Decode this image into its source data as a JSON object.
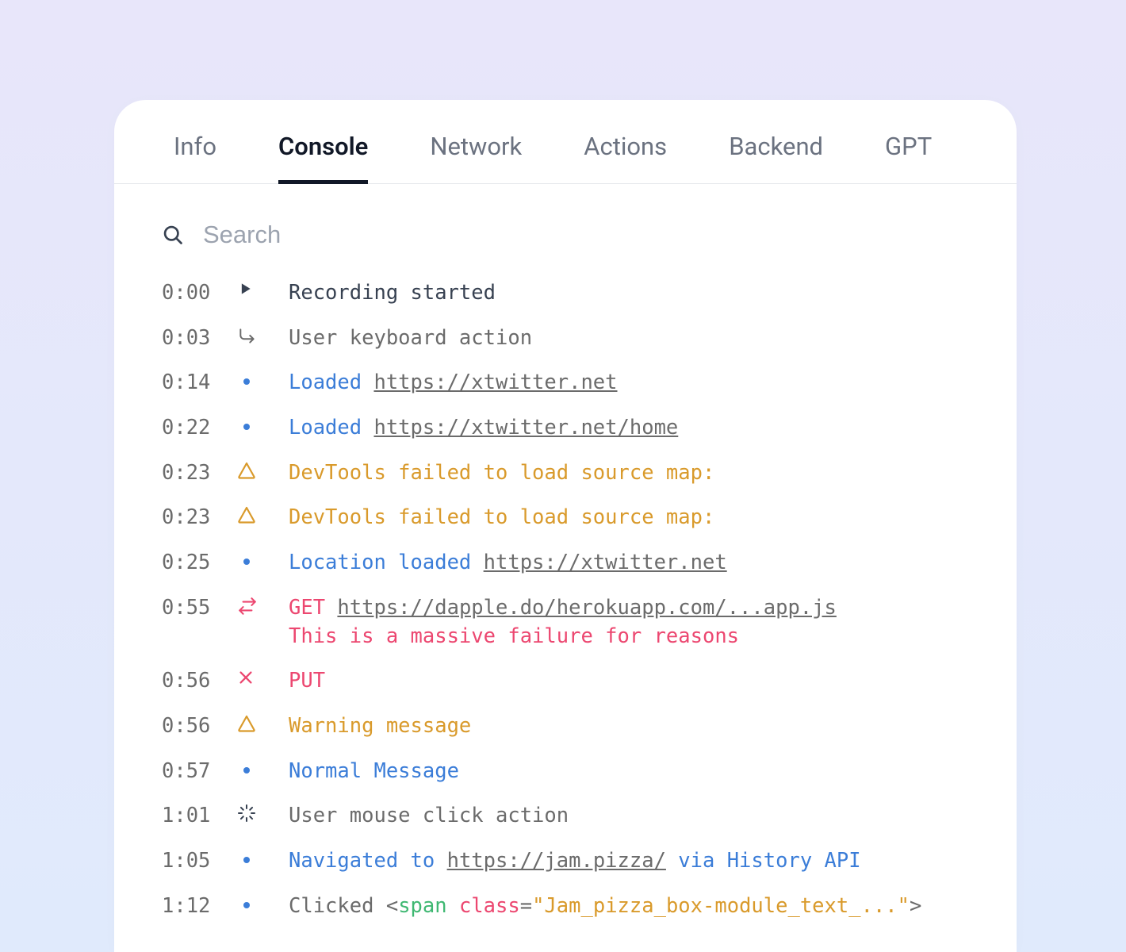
{
  "tabs": [
    {
      "label": "Info",
      "active": false
    },
    {
      "label": "Console",
      "active": true
    },
    {
      "label": "Network",
      "active": false
    },
    {
      "label": "Actions",
      "active": false
    },
    {
      "label": "Backend",
      "active": false
    },
    {
      "label": "GPT",
      "active": false
    }
  ],
  "search": {
    "placeholder": "Search"
  },
  "log": [
    {
      "ts": "0:00",
      "icon": "play",
      "msg_parts": [
        {
          "t": "Recording started",
          "c": "default"
        }
      ]
    },
    {
      "ts": "0:03",
      "icon": "sub-arrow",
      "msg_parts": [
        {
          "t": "User keyboard action",
          "c": "gray"
        }
      ]
    },
    {
      "ts": "0:14",
      "icon": "dot",
      "msg_parts": [
        {
          "t": "Loaded ",
          "c": "blue"
        },
        {
          "t": "https://xtwitter.net",
          "c": "link"
        }
      ]
    },
    {
      "ts": "0:22",
      "icon": "dot",
      "msg_parts": [
        {
          "t": "Loaded ",
          "c": "blue"
        },
        {
          "t": "https://xtwitter.net/home",
          "c": "link"
        }
      ]
    },
    {
      "ts": "0:23",
      "icon": "warn",
      "msg_parts": [
        {
          "t": "DevTools failed to load source map:",
          "c": "warn"
        }
      ]
    },
    {
      "ts": "0:23",
      "icon": "warn",
      "msg_parts": [
        {
          "t": "DevTools failed to load source map:",
          "c": "warn"
        }
      ]
    },
    {
      "ts": "0:25",
      "icon": "dot",
      "msg_parts": [
        {
          "t": "Location loaded ",
          "c": "blue"
        },
        {
          "t": "https://xtwitter.net",
          "c": "link"
        }
      ]
    },
    {
      "ts": "0:55",
      "icon": "swap",
      "msg_parts": [
        {
          "t": "GET ",
          "c": "error"
        },
        {
          "t": "https://dapple.do/herokuapp.com/...app.js",
          "c": "link"
        },
        {
          "t": "\nThis is a massive failure for reasons",
          "c": "error"
        }
      ]
    },
    {
      "ts": "0:56",
      "icon": "x",
      "msg_parts": [
        {
          "t": "PUT",
          "c": "error"
        }
      ]
    },
    {
      "ts": "0:56",
      "icon": "warn",
      "msg_parts": [
        {
          "t": "Warning message",
          "c": "warn"
        }
      ]
    },
    {
      "ts": "0:57",
      "icon": "dot",
      "msg_parts": [
        {
          "t": "Normal Message",
          "c": "blue"
        }
      ]
    },
    {
      "ts": "1:01",
      "icon": "spinner",
      "msg_parts": [
        {
          "t": "User mouse click action",
          "c": "gray"
        }
      ]
    },
    {
      "ts": "1:05",
      "icon": "dot",
      "msg_parts": [
        {
          "t": "Navigated to ",
          "c": "blue"
        },
        {
          "t": "https://jam.pizza/",
          "c": "link"
        },
        {
          "t": " via History API",
          "c": "blue"
        }
      ]
    },
    {
      "ts": "1:12",
      "icon": "dot",
      "msg_parts": [
        {
          "t": "Clicked ",
          "c": "gray"
        },
        {
          "t": "<",
          "c": "gray"
        },
        {
          "t": "span ",
          "c": "green"
        },
        {
          "t": "class",
          "c": "error"
        },
        {
          "t": "=",
          "c": "gray"
        },
        {
          "t": "\"Jam_pizza_box-module_text_...\"",
          "c": "warn"
        },
        {
          "t": ">",
          "c": "gray"
        }
      ]
    }
  ]
}
